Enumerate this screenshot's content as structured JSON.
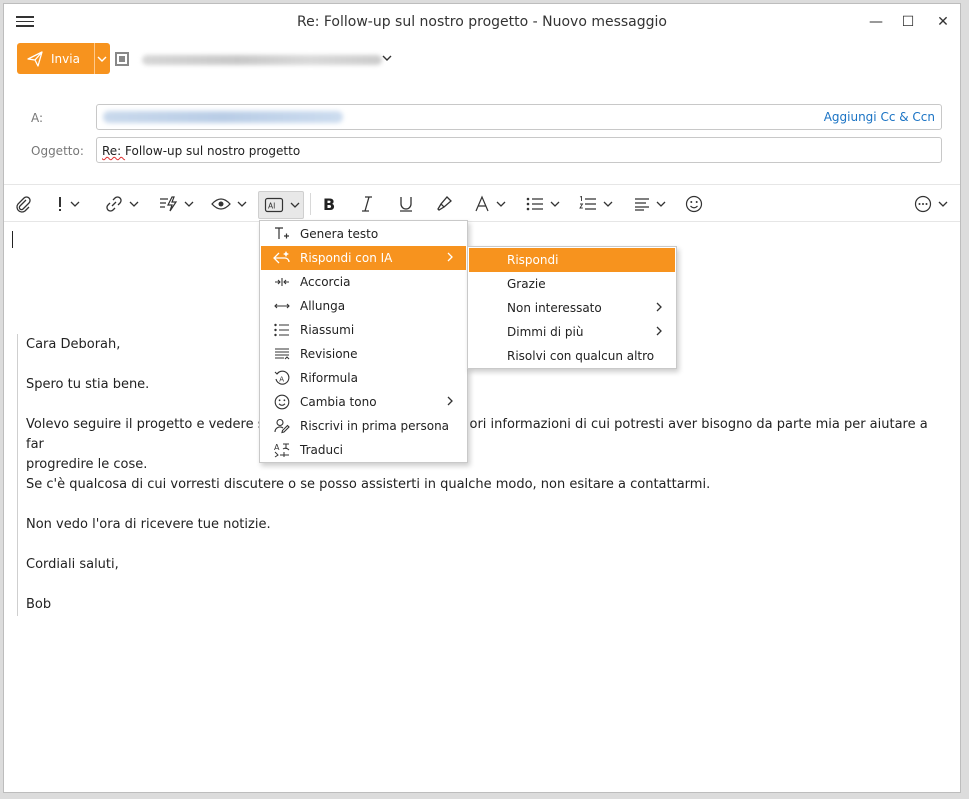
{
  "window": {
    "title": "Re: Follow-up sul nostro progetto - Nuovo messaggio",
    "minimize": "—",
    "maximize": "☐",
    "close": "✕"
  },
  "send": {
    "label": "Invia"
  },
  "header": {
    "to_label": "A:",
    "cc_link": "Aggiungi Cc & Ccn",
    "subject_label": "Oggetto:",
    "subject_prefix": "Re: ",
    "subject_rest": "Follow-up sul nostro progetto"
  },
  "ai_menu": {
    "items": [
      {
        "label": "Genera testo",
        "icon": "generate-text-icon"
      },
      {
        "label": "Rispondi con IA",
        "icon": "ai-reply-icon",
        "highlighted": true,
        "submenu": true
      },
      {
        "label": "Accorcia",
        "icon": "shorten-icon"
      },
      {
        "label": "Allunga",
        "icon": "lengthen-icon"
      },
      {
        "label": "Riassumi",
        "icon": "summarize-icon"
      },
      {
        "label": "Revisione",
        "icon": "review-icon"
      },
      {
        "label": "Riformula",
        "icon": "rephrase-icon"
      },
      {
        "label": "Cambia tono",
        "icon": "tone-icon",
        "submenu": true
      },
      {
        "label": "Riscrivi in prima persona",
        "icon": "first-person-icon"
      },
      {
        "label": "Traduci",
        "icon": "translate-icon"
      }
    ]
  },
  "reply_submenu": {
    "items": [
      {
        "label": "Rispondi",
        "highlighted": true
      },
      {
        "label": "Grazie"
      },
      {
        "label": "Non interessato",
        "submenu": true
      },
      {
        "label": "Dimmi di più",
        "submenu": true
      },
      {
        "label": "Risolvi con qualcun altro"
      }
    ]
  },
  "body": {
    "greeting": "Cara Deborah,",
    "p1": "Spero tu stia bene.",
    "p2_start": "Volevo seguire il progetto e vedere s",
    "p2_end": "ori informazioni di cui potresti aver bisogno da parte mia per aiutare a far",
    "p2_line2": "progredire le cose.",
    "p3": "Se c'è qualcosa di cui vorresti discutere o se posso assisterti in qualche modo, non esitare a contattarmi.",
    "p4": "Non vedo l'ora di ricevere tue notizie.",
    "closing": "Cordiali saluti,",
    "signature": "Bob"
  },
  "colors": {
    "accent": "#f7931e",
    "link": "#1a73c4"
  }
}
